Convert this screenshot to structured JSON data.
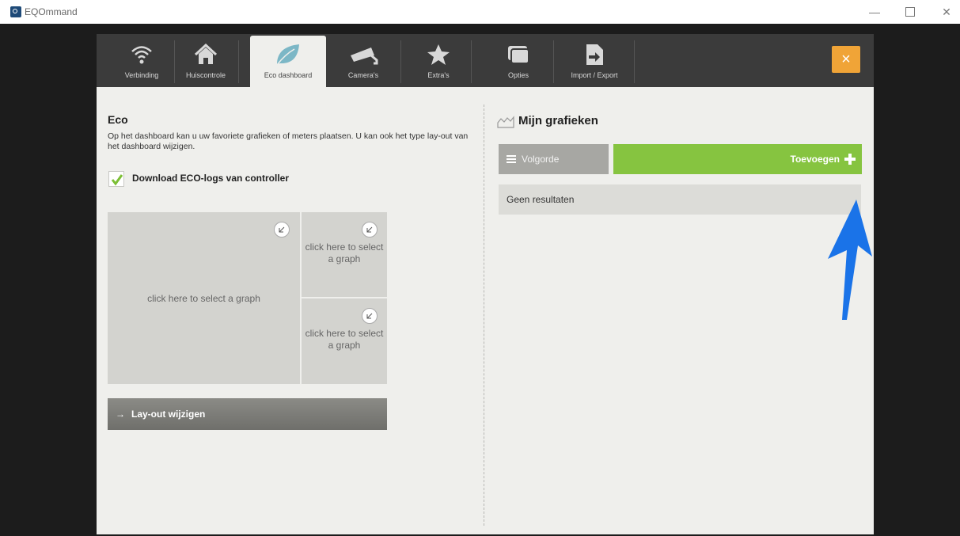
{
  "window": {
    "title": "EQOmmand",
    "minimize": "—",
    "close": "✕"
  },
  "tabs": [
    {
      "label": "Verbinding",
      "icon": "wifi-icon"
    },
    {
      "label": "Huiscontrole",
      "icon": "home-icon"
    },
    {
      "label": "Eco dashboard",
      "icon": "leaf-icon",
      "active": true
    },
    {
      "label": "Camera's",
      "icon": "camera-icon"
    },
    {
      "label": "Extra's",
      "icon": "star-icon"
    },
    {
      "label": "Opties",
      "icon": "options-icon"
    },
    {
      "label": "Import / Export",
      "icon": "import-export-icon"
    }
  ],
  "close_button": "×",
  "eco": {
    "title": "Eco",
    "description": "Op het dashboard kan u uw favoriete grafieken of meters plaatsen. U kan ook het type lay-out van het dashboard wijzigen.",
    "download_label": "Download ECO-logs van controller",
    "download_checked": true,
    "graph_big": "click here to select a graph",
    "graph_small_1": "click here to select a graph",
    "graph_small_2": "click here to select a graph",
    "layout_button": "Lay-out wijzigen",
    "layout_arrow": "→"
  },
  "graphs": {
    "title": "Mijn grafieken",
    "order_button": "Volgorde",
    "add_button": "Toevoegen",
    "empty_text": "Geen resultaten"
  },
  "colors": {
    "accent_orange": "#f0a437",
    "add_green": "#86c440",
    "annotation_blue": "#1a73e8",
    "checkbox_green": "#7cbf35"
  }
}
